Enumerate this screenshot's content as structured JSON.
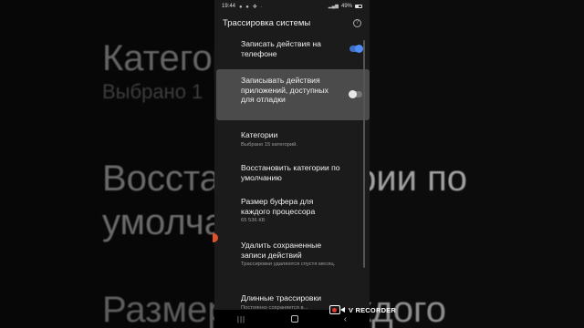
{
  "background": {
    "line1": "Категори",
    "line2": "Выбрано 1",
    "line3": "Восстан         категории по",
    "line4": "умолча",
    "line5": "Размер         для каждого"
  },
  "status_bar": {
    "time": "19:44",
    "indicators": "● ● ❖ ·",
    "battery": "49%",
    "signal_icons": "📶 ≋"
  },
  "app_bar": {
    "title": "Трассировка системы",
    "help_symbol": "?"
  },
  "settings": [
    {
      "label": "Записать действия на телефоне",
      "toggle": "on"
    },
    {
      "label": "Записывать действия приложений, доступных для отладки",
      "toggle": "off"
    },
    {
      "label": "Категории",
      "sub": "Выбрано 15 категорий."
    },
    {
      "label": "Восстановить категории по умолчанию"
    },
    {
      "label": "Размер буфера для каждого процессора",
      "sub": "65 536 КБ"
    },
    {
      "label": "Удалить сохраненные записи действий",
      "sub": "Трассировки удаляются спустя месяц."
    },
    {
      "label": "Длинные трассировки",
      "sub": "Постоянно сохраняется в..."
    }
  ],
  "navbar": {
    "recents": "|||",
    "back": "‹"
  },
  "watermark": {
    "text": "V RECORDER"
  },
  "colors": {
    "toggle_on": "#4f8ef7",
    "toggle_off": "#e8e8e8",
    "highlight": "#4b4b4b"
  }
}
